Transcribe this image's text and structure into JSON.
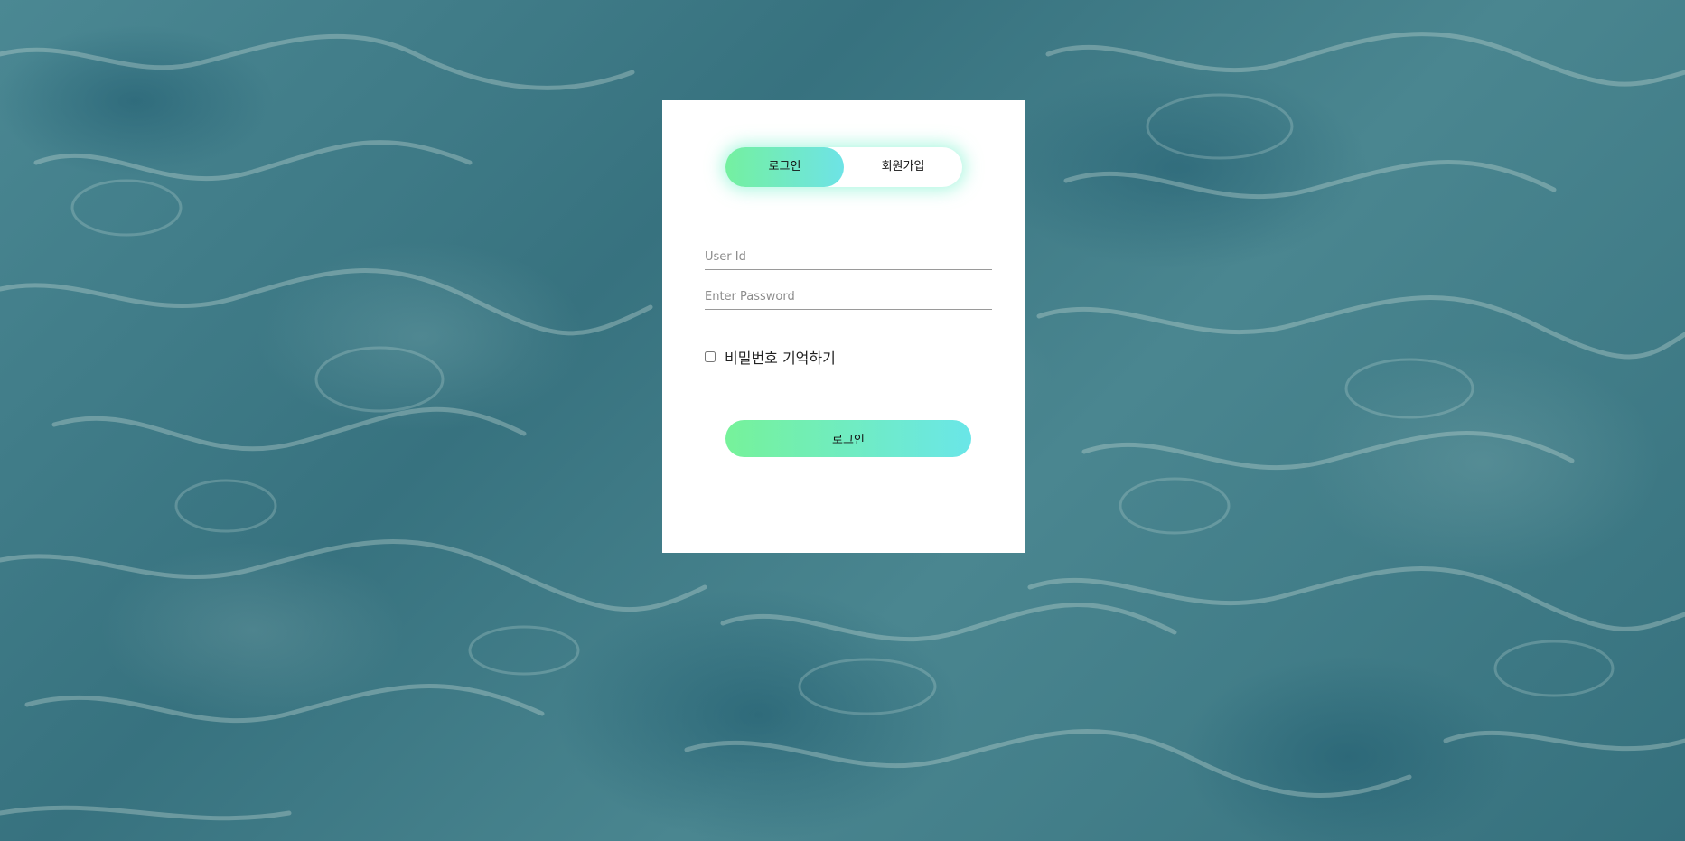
{
  "background": {
    "description_color": "#3f7d8a"
  },
  "tabs": {
    "login_label": "로그인",
    "signup_label": "회원가입",
    "active": "login"
  },
  "form": {
    "userid_placeholder": "User Id",
    "password_placeholder": "Enter Password",
    "userid_value": "",
    "password_value": "",
    "remember_label": "비밀번호 기억하기",
    "remember_checked": false,
    "submit_label": "로그인"
  },
  "colors": {
    "accent_start": "#74f0a0",
    "accent_end": "#6ee3e6"
  }
}
